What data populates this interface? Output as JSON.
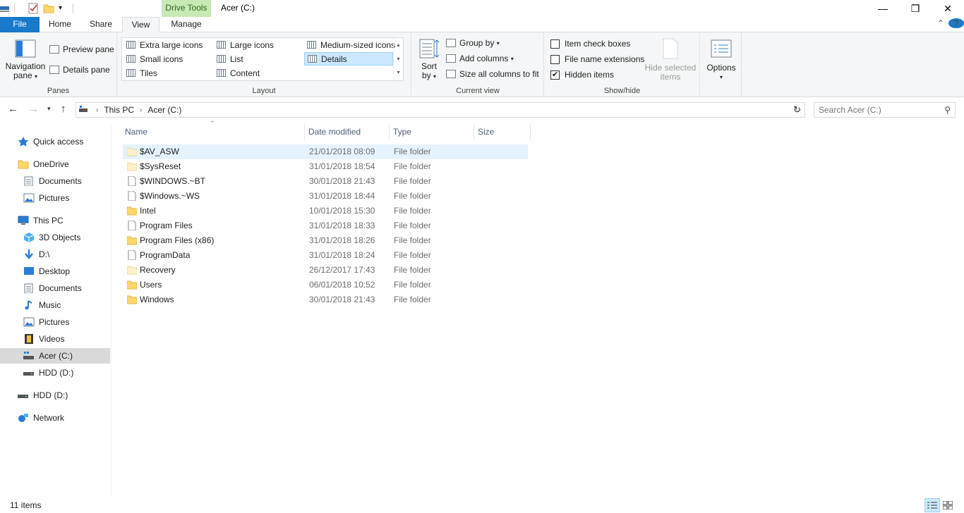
{
  "titlebar": {
    "contextual_tab": "Drive Tools",
    "window_title": "Acer (C:)",
    "minimize": "—",
    "maximize": "❐",
    "close": "✕"
  },
  "tabs": [
    {
      "label": "File"
    },
    {
      "label": "Home"
    },
    {
      "label": "Share"
    },
    {
      "label": "View",
      "active": true
    },
    {
      "label": "Manage"
    }
  ],
  "ribbon": {
    "panes": {
      "label": "Panes",
      "navigation_pane": "Navigation",
      "navigation_pane_2": "pane",
      "preview_pane": "Preview pane",
      "details_pane": "Details pane"
    },
    "layout": {
      "label": "Layout",
      "items": [
        "Extra large icons",
        "Large icons",
        "Medium-sized icons",
        "Small icons",
        "List",
        "Details",
        "Tiles",
        "Content"
      ],
      "selected": "Details"
    },
    "current_view": {
      "label": "Current view",
      "sort": "Sort",
      "sort_2": "by",
      "group_by": "Group by",
      "add_columns": "Add columns",
      "size_all": "Size all columns to fit"
    },
    "show_hide": {
      "label": "Show/hide",
      "item_check_boxes": "Item check boxes",
      "file_name_extensions": "File name extensions",
      "hidden_items": "Hidden items",
      "hidden_items_checked": true,
      "hide_selected": "Hide selected",
      "hide_selected_2": "items"
    },
    "options": {
      "label": "Options"
    }
  },
  "address": {
    "crumbs": [
      "This PC",
      "Acer (C:)"
    ]
  },
  "search": {
    "placeholder": "Search Acer (C:)"
  },
  "sidebar": {
    "items": [
      {
        "label": "Quick access",
        "icon": "star-icon"
      },
      {
        "label": "OneDrive",
        "icon": "folder-icon"
      },
      {
        "label": "Documents",
        "icon": "documents-icon"
      },
      {
        "label": "Pictures",
        "icon": "pictures-icon"
      },
      {
        "label": "This PC",
        "icon": "computer-icon"
      },
      {
        "label": "3D Objects",
        "icon": "cube-icon"
      },
      {
        "label": "D:\\",
        "icon": "download-arrow-icon"
      },
      {
        "label": "Desktop",
        "icon": "desktop-icon"
      },
      {
        "label": "Documents",
        "icon": "documents-icon"
      },
      {
        "label": "Music",
        "icon": "music-note-icon"
      },
      {
        "label": "Pictures",
        "icon": "pictures-icon"
      },
      {
        "label": "Videos",
        "icon": "film-icon"
      },
      {
        "label": "Acer (C:)",
        "icon": "windows-drive-icon",
        "selected": true
      },
      {
        "label": "HDD (D:)",
        "icon": "drive-icon"
      },
      {
        "label": "HDD (D:)",
        "icon": "drive-icon"
      },
      {
        "label": "Network",
        "icon": "network-icon"
      }
    ]
  },
  "columns": {
    "name": "Name",
    "date": "Date modified",
    "type": "Type",
    "size": "Size"
  },
  "files": [
    {
      "name": "$AV_ASW",
      "date": "21/01/2018 08:09",
      "type": "File folder",
      "icon": "faded-folder-icon",
      "highlighted": true
    },
    {
      "name": "$SysReset",
      "date": "31/01/2018 18:54",
      "type": "File folder",
      "icon": "faded-folder-icon"
    },
    {
      "name": "$WINDOWS.~BT",
      "date": "30/01/2018 21:43",
      "type": "File folder",
      "icon": "blank-page-icon"
    },
    {
      "name": "$Windows.~WS",
      "date": "31/01/2018 18:44",
      "type": "File folder",
      "icon": "blank-page-icon"
    },
    {
      "name": "Intel",
      "date": "10/01/2018 15:30",
      "type": "File folder",
      "icon": "folder-icon"
    },
    {
      "name": "Program Files",
      "date": "31/01/2018 18:33",
      "type": "File folder",
      "icon": "blank-page-icon"
    },
    {
      "name": "Program Files (x86)",
      "date": "31/01/2018 18:26",
      "type": "File folder",
      "icon": "folder-icon"
    },
    {
      "name": "ProgramData",
      "date": "31/01/2018 18:24",
      "type": "File folder",
      "icon": "blank-page-icon"
    },
    {
      "name": "Recovery",
      "date": "26/12/2017 17:43",
      "type": "File folder",
      "icon": "faded-folder-icon"
    },
    {
      "name": "Users",
      "date": "06/01/2018 10:52",
      "type": "File folder",
      "icon": "folder-icon"
    },
    {
      "name": "Windows",
      "date": "30/01/2018 21:43",
      "type": "File folder",
      "icon": "folder-icon"
    }
  ],
  "status": {
    "item_count": "11 items"
  },
  "colors": {
    "accent": "#1979ca",
    "contextual_tab": "#c7e9b4",
    "selection": "#cce8ff",
    "folder": "#ffd76b"
  }
}
